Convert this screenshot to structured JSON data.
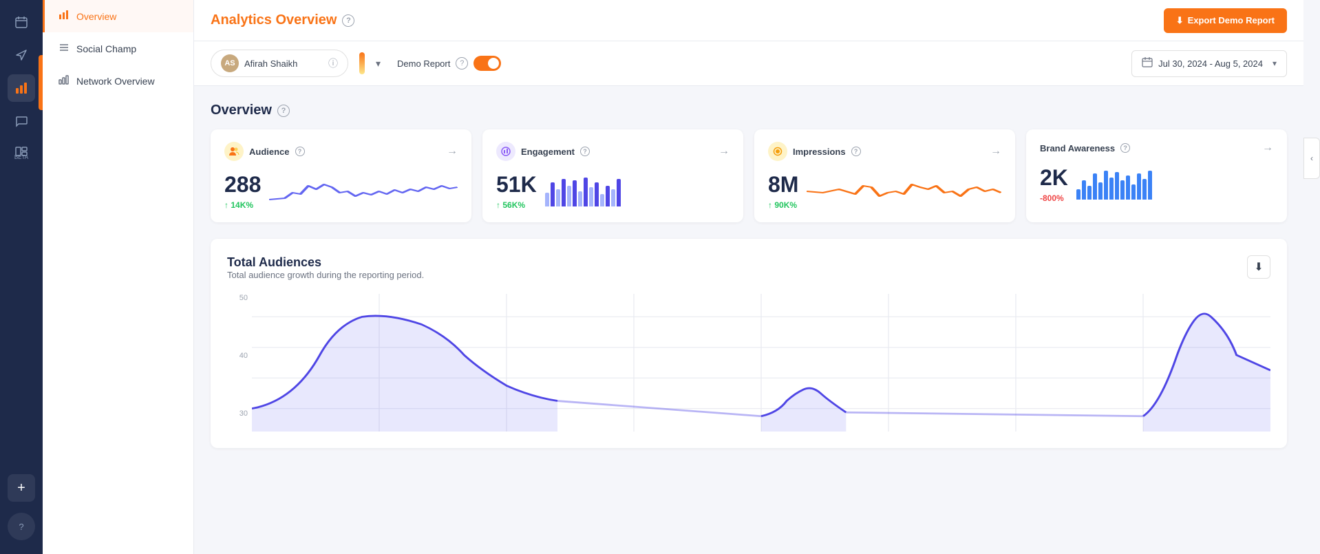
{
  "sidebar": {
    "icons": [
      {
        "name": "calendar-icon",
        "symbol": "▦",
        "active": false
      },
      {
        "name": "send-icon",
        "symbol": "✈",
        "active": false
      },
      {
        "name": "analytics-icon",
        "symbol": "▦",
        "active": true
      },
      {
        "name": "comments-icon",
        "symbol": "💬",
        "active": false
      },
      {
        "name": "beta-icon",
        "symbol": "▦",
        "active": false,
        "beta": "BETA"
      }
    ],
    "bottom_icons": [
      {
        "name": "add-icon",
        "symbol": "+"
      },
      {
        "name": "help-icon",
        "symbol": "?"
      }
    ]
  },
  "nav": {
    "items": [
      {
        "label": "Overview",
        "active": true,
        "icon": "📊"
      },
      {
        "label": "Social Champ",
        "active": false,
        "icon": "≡"
      },
      {
        "label": "Network Overview",
        "active": false,
        "icon": "📈"
      }
    ]
  },
  "header": {
    "title": "Analytics Overview",
    "export_button": "Export Demo Report"
  },
  "filter_bar": {
    "profile_name": "Afirah Shaikh",
    "demo_report_label": "Demo Report",
    "date_range": "Jul 30, 2024 - Aug 5, 2024"
  },
  "overview": {
    "section_title": "Overview",
    "cards": [
      {
        "label": "Audience",
        "value": "288",
        "change": "14K%",
        "change_type": "positive",
        "chart_type": "line",
        "icon": "🟠"
      },
      {
        "label": "Engagement",
        "value": "51K",
        "change": "56K%",
        "change_type": "positive",
        "chart_type": "bar",
        "icon": "🟣"
      },
      {
        "label": "Impressions",
        "value": "8M",
        "change": "90K%",
        "change_type": "positive",
        "chart_type": "line",
        "icon": "🟡"
      },
      {
        "label": "Brand Awareness",
        "value": "2K",
        "change": "-800%",
        "change_type": "negative",
        "chart_type": "bar",
        "icon": "🔵"
      }
    ]
  },
  "total_audiences": {
    "title": "Total Audiences",
    "subtitle": "Total audience growth during the reporting period.",
    "y_labels": [
      "50",
      "40",
      "30"
    ],
    "download_label": "⬇"
  }
}
